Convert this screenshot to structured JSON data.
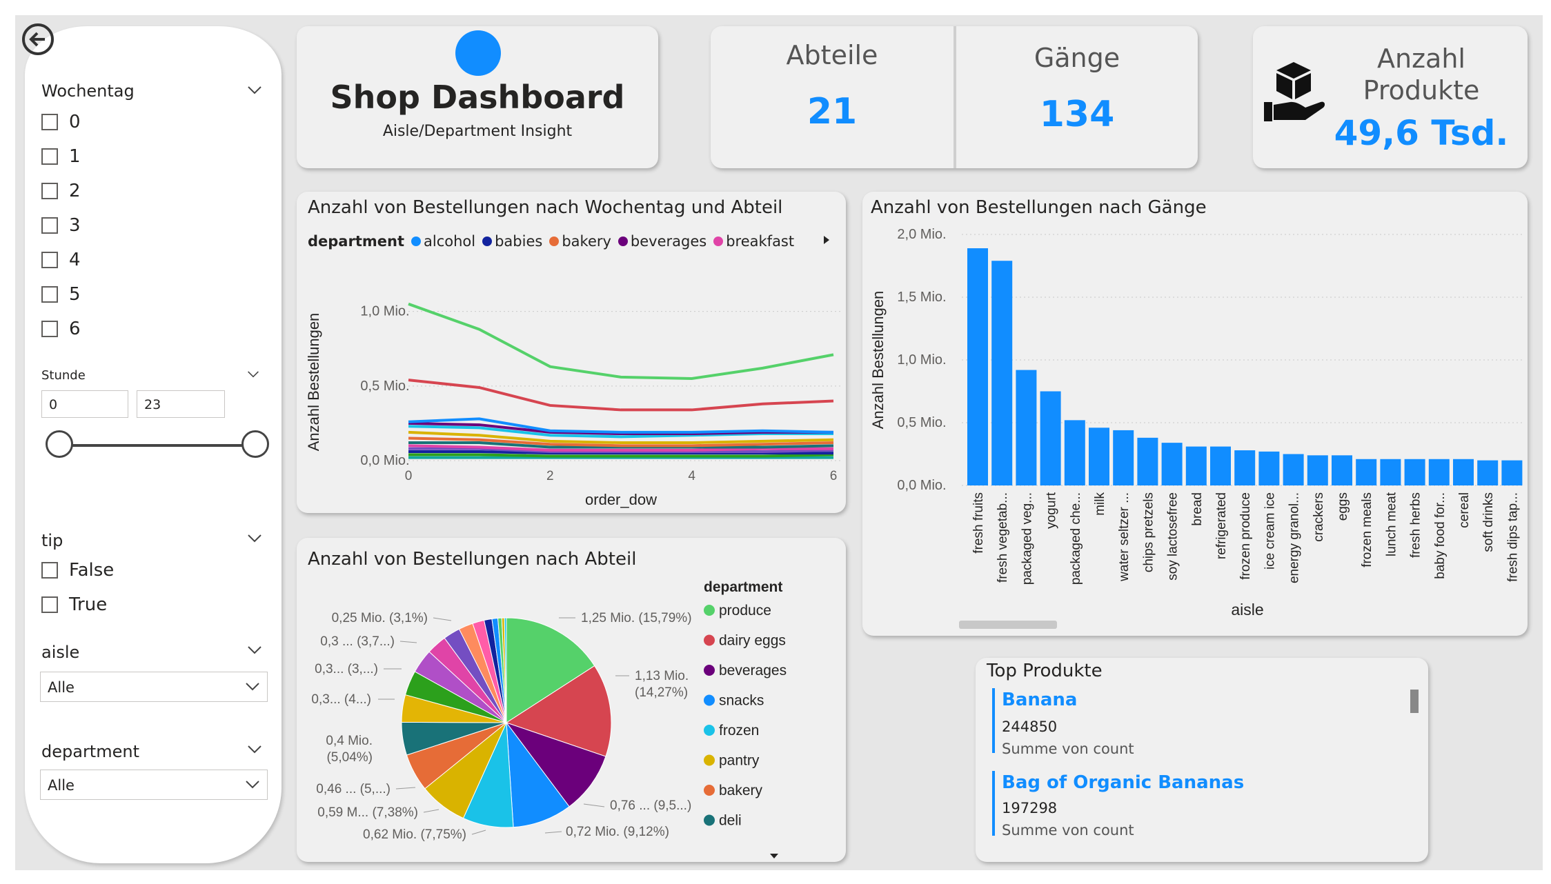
{
  "colors": {
    "accent": "#118dff"
  },
  "filters": {
    "wochentag": {
      "label": "Wochentag",
      "options": [
        "0",
        "1",
        "2",
        "3",
        "4",
        "5",
        "6"
      ]
    },
    "stunde": {
      "label": "Stunde",
      "min": "0",
      "max": "23"
    },
    "tip": {
      "label": "tip",
      "options": [
        "False",
        "True"
      ]
    },
    "aisle": {
      "label": "aisle",
      "selected": "Alle"
    },
    "department": {
      "label": "department",
      "selected": "Alle"
    }
  },
  "header": {
    "title": "Shop Dashboard",
    "subtitle": "Aisle/Department Insight"
  },
  "kpis": {
    "abteile": {
      "label": "Abteile",
      "value": "21"
    },
    "gaenge": {
      "label": "Gänge",
      "value": "134"
    },
    "produkte": {
      "label_line1": "Anzahl",
      "label_line2": "Produkte",
      "value": "49,6 Tsd."
    }
  },
  "line_chart": {
    "title": "Anzahl von Bestellungen nach Wochentag und Abteil",
    "legend_title": "department",
    "legend": [
      {
        "name": "alcohol",
        "color": "#118dff"
      },
      {
        "name": "babies",
        "color": "#12239e"
      },
      {
        "name": "bakery",
        "color": "#e66c37"
      },
      {
        "name": "beverages",
        "color": "#6b007b"
      },
      {
        "name": "breakfast",
        "color": "#e044a7"
      }
    ]
  },
  "bar_chart": {
    "title": "Anzahl von Bestellungen nach Gänge"
  },
  "pie_chart": {
    "title": "Anzahl von Bestellungen nach Abteil",
    "legend_title": "department",
    "labels": [
      {
        "text": "1,25 Mio. (15,79%)"
      },
      {
        "text": "1,13 Mio."
      },
      {
        "text": "(14,27%)"
      },
      {
        "text": "0,76 ... (9,5...)"
      },
      {
        "text": "0,72 Mio. (9,12%)"
      },
      {
        "text": "0,62 Mio. (7,75%)"
      },
      {
        "text": "0,59 M... (7,38%)"
      },
      {
        "text": "0,46 ... (5,...)"
      },
      {
        "text": "0,4 Mio."
      },
      {
        "text": "(5,04%)"
      },
      {
        "text": "0,3... (4...)"
      },
      {
        "text": "0,3... (3,...)"
      },
      {
        "text": "0,3 ... (3,7...)"
      },
      {
        "text": "0,25 Mio. (3,1%)"
      }
    ]
  },
  "chart_data": [
    {
      "type": "line",
      "title": "Anzahl von Bestellungen nach Wochentag und Abteil",
      "xlabel": "order_dow",
      "ylabel": "Anzahl Bestellungen",
      "x": [
        0,
        1,
        2,
        3,
        4,
        5,
        6
      ],
      "x_ticks": [
        "0",
        "2",
        "4",
        "6"
      ],
      "y_ticks": [
        "0,0 Mio.",
        "0,5 Mio.",
        "1,0 Mio."
      ],
      "ylim": [
        0,
        1.1
      ],
      "grid": true,
      "legend_position": "top",
      "series": [
        {
          "color": "#55d16a",
          "values": [
            1.05,
            0.88,
            0.63,
            0.56,
            0.55,
            0.62,
            0.71
          ]
        },
        {
          "color": "#d64550",
          "values": [
            0.54,
            0.49,
            0.37,
            0.34,
            0.34,
            0.38,
            0.4
          ]
        },
        {
          "color": "#118dff",
          "values": [
            0.26,
            0.28,
            0.2,
            0.19,
            0.19,
            0.2,
            0.19
          ]
        },
        {
          "color": "#6b007b",
          "values": [
            0.25,
            0.24,
            0.19,
            0.18,
            0.18,
            0.19,
            0.19
          ]
        },
        {
          "color": "#1ac2e8",
          "values": [
            0.23,
            0.22,
            0.17,
            0.16,
            0.17,
            0.18,
            0.18
          ]
        },
        {
          "color": "#d9b300",
          "values": [
            0.19,
            0.17,
            0.13,
            0.12,
            0.12,
            0.13,
            0.14
          ]
        },
        {
          "color": "#e66c37",
          "values": [
            0.15,
            0.14,
            0.11,
            0.1,
            0.1,
            0.11,
            0.12
          ]
        },
        {
          "color": "#197278",
          "values": [
            0.12,
            0.12,
            0.09,
            0.09,
            0.09,
            0.09,
            0.1
          ]
        },
        {
          "color": "#e044a7",
          "values": [
            0.1,
            0.09,
            0.07,
            0.07,
            0.07,
            0.08,
            0.08
          ]
        },
        {
          "color": "#744ec2",
          "values": [
            0.08,
            0.08,
            0.06,
            0.06,
            0.06,
            0.06,
            0.07
          ]
        },
        {
          "color": "#12239e",
          "values": [
            0.06,
            0.06,
            0.05,
            0.05,
            0.05,
            0.05,
            0.05
          ]
        },
        {
          "color": "#2ca01c",
          "values": [
            0.04,
            0.04,
            0.03,
            0.03,
            0.03,
            0.03,
            0.04
          ]
        },
        {
          "color": "#12a89d",
          "values": [
            0.02,
            0.02,
            0.02,
            0.02,
            0.02,
            0.02,
            0.02
          ]
        }
      ]
    },
    {
      "type": "bar",
      "title": "Anzahl von Bestellungen nach Gänge",
      "xlabel": "aisle",
      "ylabel": "Anzahl Bestellungen",
      "y_ticks": [
        "0,0 Mio.",
        "0,5 Mio.",
        "1,0 Mio.",
        "1,5 Mio.",
        "2,0 Mio."
      ],
      "ylim": [
        0,
        2.0
      ],
      "grid": true,
      "color": "#118dff",
      "categories": [
        "fresh fruits",
        "fresh vegetab...",
        "packaged veg...",
        "yogurt",
        "packaged che...",
        "milk",
        "water seltzer ...",
        "chips pretzels",
        "soy lactosefree",
        "bread",
        "refrigerated",
        "frozen produce",
        "ice cream ice",
        "energy granol...",
        "crackers",
        "eggs",
        "frozen meals",
        "lunch meat",
        "fresh herbs",
        "baby food for...",
        "cereal",
        "soft drinks",
        "fresh dips tap..."
      ],
      "values": [
        1.89,
        1.79,
        0.92,
        0.75,
        0.52,
        0.46,
        0.44,
        0.38,
        0.34,
        0.31,
        0.31,
        0.28,
        0.27,
        0.25,
        0.24,
        0.24,
        0.21,
        0.21,
        0.21,
        0.21,
        0.21,
        0.2,
        0.2
      ]
    },
    {
      "type": "pie",
      "title": "Anzahl von Bestellungen nach Abteil",
      "legend_title": "department",
      "legend_position": "right",
      "legend": [
        "produce",
        "dairy eggs",
        "beverages",
        "snacks",
        "frozen",
        "pantry",
        "bakery",
        "deli"
      ],
      "slices": [
        {
          "name": "produce",
          "value": 15.79,
          "color": "#55d16a"
        },
        {
          "name": "dairy eggs",
          "value": 14.27,
          "color": "#d64550"
        },
        {
          "name": "beverages",
          "value": 9.5,
          "color": "#6b007b"
        },
        {
          "name": "snacks",
          "value": 9.12,
          "color": "#118dff"
        },
        {
          "name": "frozen",
          "value": 7.75,
          "color": "#1ac2e8"
        },
        {
          "name": "pantry",
          "value": 7.38,
          "color": "#d9b300"
        },
        {
          "name": "bakery",
          "value": 5.8,
          "color": "#e66c37"
        },
        {
          "name": "deli",
          "value": 5.04,
          "color": "#197278"
        },
        {
          "name": "",
          "value": 4.2,
          "color": "#e3b505"
        },
        {
          "name": "",
          "value": 3.8,
          "color": "#2ca01c"
        },
        {
          "name": "",
          "value": 3.7,
          "color": "#b04fc7"
        },
        {
          "name": "",
          "value": 3.1,
          "color": "#e044a7"
        },
        {
          "name": "",
          "value": 2.6,
          "color": "#744ec2"
        },
        {
          "name": "",
          "value": 2.2,
          "color": "#fe8b5e"
        },
        {
          "name": "",
          "value": 1.8,
          "color": "#ff5ca8"
        },
        {
          "name": "",
          "value": 1.2,
          "color": "#12239e"
        },
        {
          "name": "",
          "value": 0.9,
          "color": "#118dff"
        },
        {
          "name": "",
          "value": 0.6,
          "color": "#55d16a"
        },
        {
          "name": "",
          "value": 0.4,
          "color": "#d9b300"
        },
        {
          "name": "",
          "value": 0.3,
          "color": "#1ac2e8"
        }
      ]
    }
  ],
  "top_products": {
    "title": "Top Produkte",
    "items": [
      {
        "name": "Banana",
        "count": "244850",
        "label": "Summe von count"
      },
      {
        "name": "Bag of Organic Bananas",
        "count": "197298",
        "label": "Summe von count"
      }
    ]
  }
}
